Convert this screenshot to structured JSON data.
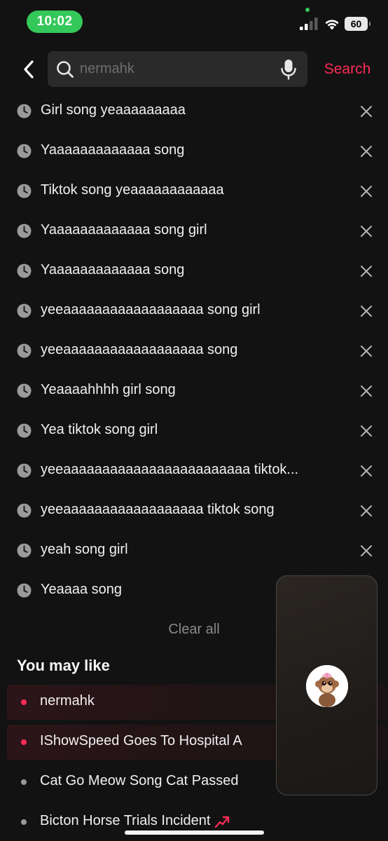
{
  "status": {
    "time": "10:02",
    "battery": "60"
  },
  "search": {
    "placeholder": "nermahk",
    "button_label": "Search"
  },
  "history": [
    "Girl song yeaaaaaaaaa",
    "Yaaaaaaaaaaaaa song",
    "Tiktok song yeaaaaaaaaaaaa",
    "Yaaaaaaaaaaaaa song girl",
    "Yaaaaaaaaaaaaa song",
    "yeeaaaaaaaaaaaaaaaaaa song girl",
    "yeeaaaaaaaaaaaaaaaaaa song",
    "Yeaaaahhhh girl song",
    "Yea tiktok song girl",
    "yeeaaaaaaaaaaaaaaaaaaaaaaaa tiktok...",
    "yeeaaaaaaaaaaaaaaaaaa tiktok song",
    "yeah song girl",
    "Yeaaaa song"
  ],
  "clear_all_label": "Clear all",
  "you_may_like": {
    "title": "You may like",
    "items": [
      {
        "label": "nermahk",
        "hot": true
      },
      {
        "label": "IShowSpeed Goes To Hospital A",
        "hot": true
      },
      {
        "label": "Cat Go Meow Song Cat Passed",
        "hot": false
      },
      {
        "label": "Bicton Horse Trials Incident",
        "hot": false,
        "trending": true
      }
    ]
  },
  "colors": {
    "accent": "#fe2c55",
    "status_pill": "#34c759",
    "background": "#121212"
  },
  "icons": {
    "back": "chevron-left-icon",
    "search": "search-icon",
    "mic": "microphone-icon",
    "history": "clock-icon",
    "remove": "close-icon",
    "trend": "trending-up-icon"
  }
}
